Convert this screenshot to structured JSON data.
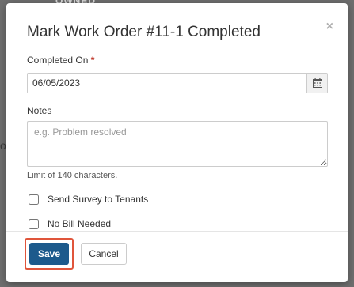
{
  "backdrop": {
    "header_fragment": "OWNED",
    "side_fragment": "o"
  },
  "modal": {
    "title": "Mark Work Order #11-1 Completed",
    "close_label": "×",
    "completed_on": {
      "label": "Completed On",
      "required_mark": "*",
      "value": "06/05/2023"
    },
    "notes": {
      "label": "Notes",
      "placeholder": "e.g. Problem resolved",
      "value": "",
      "help": "Limit of 140 characters."
    },
    "checkboxes": [
      {
        "label": "Send Survey to Tenants",
        "checked": false
      },
      {
        "label": "No Bill Needed",
        "checked": false
      }
    ],
    "buttons": {
      "save": "Save",
      "cancel": "Cancel"
    }
  },
  "colors": {
    "primary": "#1c5a8c",
    "highlight": "#e0553b",
    "required": "#c0392b"
  },
  "icons": {
    "calendar": "calendar-icon",
    "close": "close-icon"
  }
}
